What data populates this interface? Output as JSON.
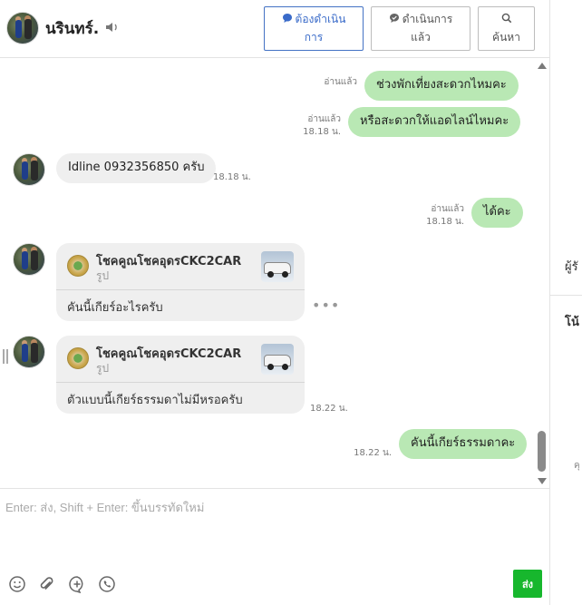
{
  "header": {
    "contact_name": "นรินทร์.",
    "buttons": {
      "todo": {
        "line1": "ต้องดำเนิน",
        "line2": "การ"
      },
      "done": {
        "line1": "ดำเนินการ",
        "line2": "แล้ว"
      },
      "search": "ค้นหา"
    }
  },
  "messages": [
    {
      "dir": "out",
      "text": "ช่วงพักเที่ยงสะดวกไหมคะ",
      "read": "อ่านแล้ว",
      "time": ""
    },
    {
      "dir": "out",
      "text": "หรือสะดวกให้แอดไลน์ไหมคะ",
      "read": "อ่านแล้ว",
      "time": "18.18 น."
    },
    {
      "dir": "in",
      "text": "Idline 0932356850 ครับ",
      "time": "18.18 น."
    },
    {
      "dir": "out",
      "text": "ได้คะ",
      "read": "อ่านแล้ว",
      "time": "18.18 น."
    },
    {
      "dir": "in",
      "card_title": "โชคคูณโชคอุดรCKC2CAR",
      "card_sub": "รูป",
      "text": "คันนี้เกียร์อะไรครับ"
    },
    {
      "dir": "in",
      "card_title": "โชคคูณโชคอุดรCKC2CAR",
      "card_sub": "รูป",
      "text": "ตัวแบบนี้เกียร์ธรรมดาไม่มีหรอครับ",
      "time": "18.22 น."
    },
    {
      "dir": "out",
      "text": "คันนี้เกียร์ธรรมดาคะ",
      "time": "18.22 น."
    }
  ],
  "composer": {
    "placeholder": "Enter: ส่ง, Shift + Enter: ขึ้นบรรทัดใหม่",
    "send_label": "ส่ง"
  },
  "right_panel": {
    "label1": "ผู้รั",
    "label2": "โน้",
    "label3": "คุ"
  },
  "colors": {
    "outgoing_bubble": "#b9e8b4",
    "incoming_bubble": "#efefef",
    "send_button": "#17b72d",
    "primary_button": "#3a6bc9"
  }
}
